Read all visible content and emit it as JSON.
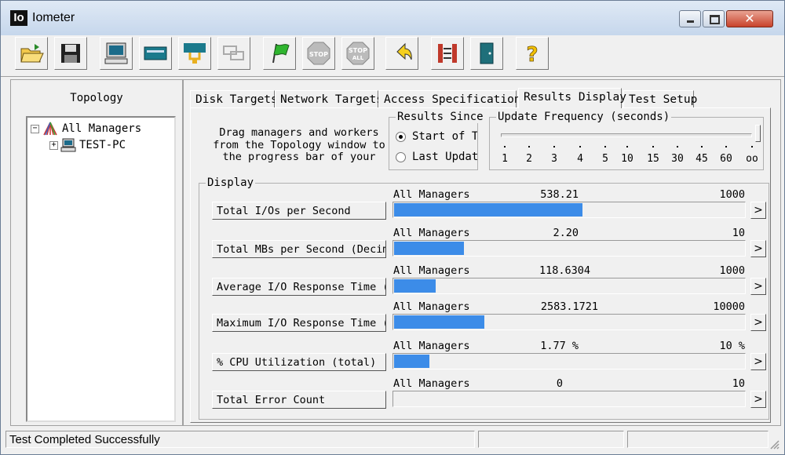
{
  "window": {
    "title": "Iometer",
    "icon_text": "Io"
  },
  "toolbar": {
    "buttons": [
      {
        "name": "open-config",
        "icon": "folder-open-icon"
      },
      {
        "name": "save-config",
        "icon": "floppy-disk-icon"
      },
      {
        "name": "start-disk-worker",
        "icon": "computer-icon"
      },
      {
        "name": "start-network-worker",
        "icon": "network-worker-icon"
      },
      {
        "name": "new-manager",
        "icon": "manager-icon"
      },
      {
        "name": "duplicate-worker",
        "icon": "duplicate-icon"
      },
      {
        "name": "start-tests",
        "icon": "green-flag-icon"
      },
      {
        "name": "stop",
        "icon": "stop-icon",
        "label": "STOP"
      },
      {
        "name": "stop-all",
        "icon": "stop-all-icon",
        "label": "STOP ALL"
      },
      {
        "name": "reset-workers",
        "icon": "reset-arrow-icon"
      },
      {
        "name": "exit-managers",
        "icon": "disconnect-icon"
      },
      {
        "name": "exit",
        "icon": "exit-door-icon"
      },
      {
        "name": "help",
        "icon": "help-icon",
        "label": "?"
      }
    ]
  },
  "topology": {
    "title": "Topology",
    "tree": [
      {
        "label": "All Managers",
        "icon": "all-managers-icon",
        "expander": "−"
      },
      {
        "label": "TEST-PC",
        "icon": "computer-icon",
        "expander": "+"
      }
    ]
  },
  "tabs": [
    {
      "label": "Disk Targets",
      "active": false
    },
    {
      "label": "Network Targets",
      "active": false
    },
    {
      "label": "Access Specifications",
      "active": false
    },
    {
      "label": "Results Display",
      "active": true
    },
    {
      "label": "Test Setup",
      "active": false
    }
  ],
  "results_display": {
    "drag_help": "Drag managers and workers from the Topology window to the progress bar of your choice.",
    "results_since": {
      "caption": "Results Since",
      "options": [
        {
          "label": "Start of Test",
          "selected": true
        },
        {
          "label": "Last Update",
          "selected": false
        }
      ]
    },
    "update_frequency": {
      "caption": "Update Frequency (seconds)",
      "ticks": [
        "1",
        "2",
        "3",
        "4",
        "5",
        "10",
        "15",
        "30",
        "45",
        "60",
        "oo"
      ],
      "selected": "oo"
    },
    "display": {
      "caption": "Display",
      "rows": [
        {
          "label": "Total I/Os per Second",
          "manager": "All Managers",
          "value": "538.21",
          "max": "1000",
          "fraction": 0.538
        },
        {
          "label": "Total MBs per Second (Decimal)",
          "manager": "All Managers",
          "value": "2.20",
          "max": "10",
          "fraction": 0.2
        },
        {
          "label": "Average I/O Response Time (ms)",
          "manager": "All Managers",
          "value": "118.6304",
          "max": "1000",
          "fraction": 0.119
        },
        {
          "label": "Maximum I/O Response Time (ms)",
          "manager": "All Managers",
          "value": "2583.1721",
          "max": "10000",
          "fraction": 0.258
        },
        {
          "label": "% CPU Utilization (total)",
          "manager": "All Managers",
          "value": "1.77 %",
          "max": "10 %",
          "fraction": 0.1
        },
        {
          "label": "Total Error Count",
          "manager": "All Managers",
          "value": "0",
          "max": "10",
          "fraction": 0
        }
      ],
      "arrow": ">"
    }
  },
  "statusbar": {
    "message": "Test Completed Successfully"
  },
  "colors": {
    "bar_fill": "#3c8ce8",
    "close_button": "#c8432c"
  }
}
